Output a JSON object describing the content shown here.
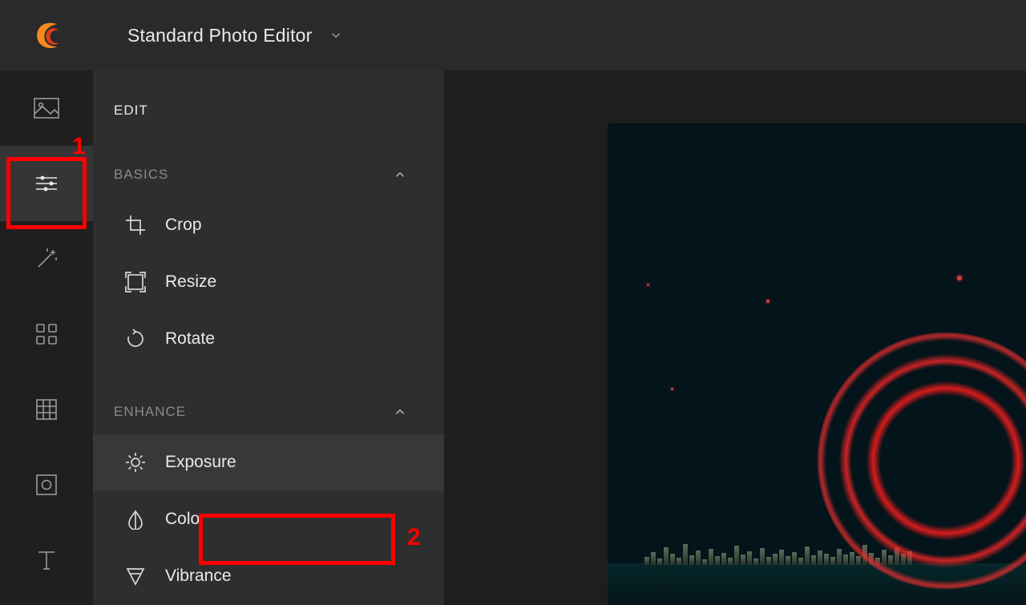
{
  "header": {
    "title": "Standard Photo Editor"
  },
  "toolstrip": {
    "items": [
      {
        "name": "image-tool"
      },
      {
        "name": "sliders-tool",
        "active": true
      },
      {
        "name": "magic-wand-tool"
      },
      {
        "name": "grid-tool"
      },
      {
        "name": "matrix-tool"
      },
      {
        "name": "camera-tool"
      },
      {
        "name": "text-tool"
      }
    ]
  },
  "panel": {
    "title": "EDIT",
    "sections": [
      {
        "label": "BASICS",
        "expanded": true,
        "items": [
          {
            "icon": "crop-icon",
            "label": "Crop"
          },
          {
            "icon": "resize-icon",
            "label": "Resize"
          },
          {
            "icon": "rotate-icon",
            "label": "Rotate"
          }
        ]
      },
      {
        "label": "ENHANCE",
        "expanded": true,
        "items": [
          {
            "icon": "exposure-icon",
            "label": "Exposure",
            "selected": true
          },
          {
            "icon": "color-icon",
            "label": "Color"
          },
          {
            "icon": "vibrance-icon",
            "label": "Vibrance"
          }
        ]
      }
    ]
  },
  "annotations": {
    "markers": [
      {
        "number": "1",
        "target": "sliders-tool"
      },
      {
        "number": "2",
        "target": "exposure-item"
      }
    ]
  }
}
